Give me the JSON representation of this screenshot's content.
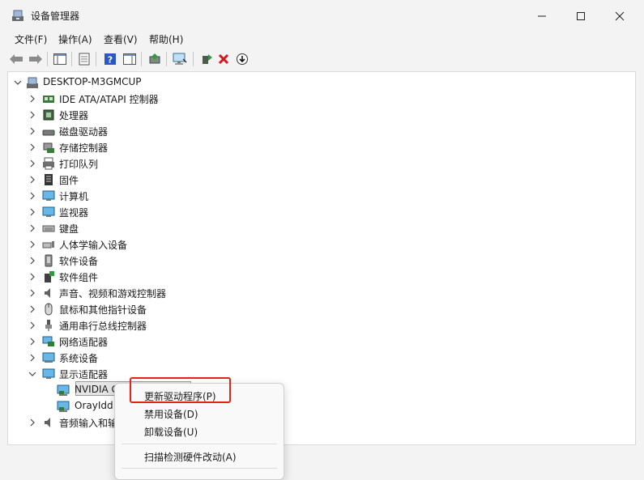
{
  "window": {
    "title": "设备管理器"
  },
  "menubar": [
    {
      "label": "文件(F)"
    },
    {
      "label": "操作(A)"
    },
    {
      "label": "查看(V)"
    },
    {
      "label": "帮助(H)"
    }
  ],
  "tree": {
    "root": "DESKTOP-M3GMCUP",
    "categories": [
      {
        "label": "IDE ATA/ATAPI 控制器",
        "icon": "ide-controller-icon"
      },
      {
        "label": "处理器",
        "icon": "processor-icon"
      },
      {
        "label": "磁盘驱动器",
        "icon": "disk-drive-icon"
      },
      {
        "label": "存储控制器",
        "icon": "storage-controller-icon"
      },
      {
        "label": "打印队列",
        "icon": "printer-icon"
      },
      {
        "label": "固件",
        "icon": "firmware-icon"
      },
      {
        "label": "计算机",
        "icon": "computer-icon"
      },
      {
        "label": "监视器",
        "icon": "monitor-icon"
      },
      {
        "label": "键盘",
        "icon": "keyboard-icon"
      },
      {
        "label": "人体学输入设备",
        "icon": "hid-icon"
      },
      {
        "label": "软件设备",
        "icon": "software-device-icon"
      },
      {
        "label": "软件组件",
        "icon": "software-component-icon"
      },
      {
        "label": "声音、视频和游戏控制器",
        "icon": "sound-icon"
      },
      {
        "label": "鼠标和其他指针设备",
        "icon": "mouse-icon"
      },
      {
        "label": "通用串行总线控制器",
        "icon": "usb-icon"
      },
      {
        "label": "网络适配器",
        "icon": "network-adapter-icon"
      },
      {
        "label": "系统设备",
        "icon": "system-device-icon"
      },
      {
        "label": "显示适配器",
        "icon": "display-adapter-icon"
      }
    ],
    "display_children": [
      {
        "label": "NVIDIA G"
      },
      {
        "label": "OrayIdd"
      }
    ],
    "after": {
      "label": "音频输入和输"
    }
  },
  "context_menu": {
    "items": [
      {
        "label": "更新驱动程序(P)"
      },
      {
        "label": "禁用设备(D)"
      },
      {
        "label": "卸载设备(U)"
      },
      {
        "label": "扫描检测硬件改动(A)"
      }
    ]
  },
  "colors": {
    "highlight_border": "#e2231a",
    "selection_bg": "#e5e5e5"
  }
}
